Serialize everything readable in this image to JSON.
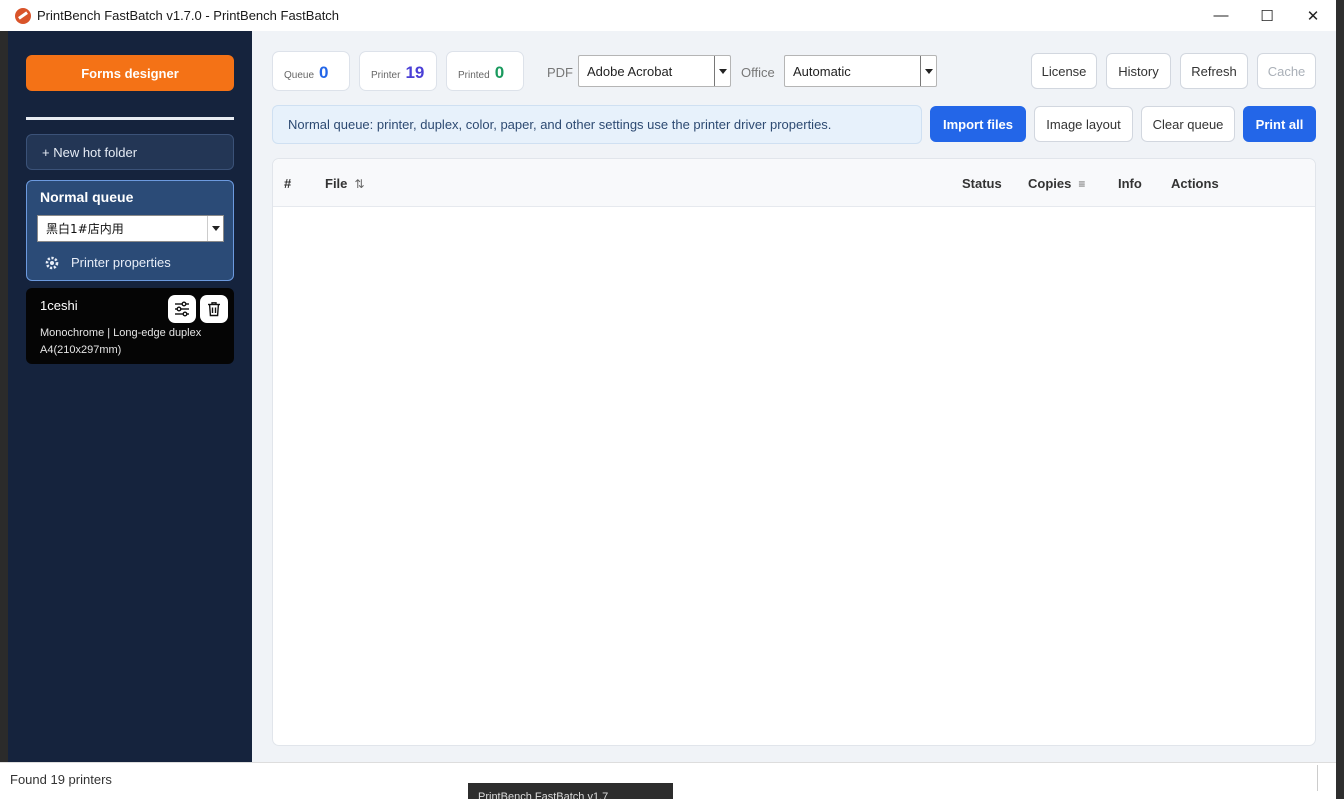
{
  "window": {
    "title": "PrintBench FastBatch v1.7.0 - PrintBench FastBatch",
    "minimize": "—",
    "maximize": "☐",
    "close": "✕"
  },
  "sidebar": {
    "forms_designer": "Forms designer",
    "new_hot_folder": "+ New hot folder",
    "queue": {
      "title": "Normal queue",
      "printer": "黑白1#店内用",
      "printer_properties": "Printer properties"
    },
    "preset": {
      "name": "1ceshi",
      "line1": "Monochrome | Long-edge duplex",
      "line2": "A4(210x297mm)"
    }
  },
  "stats": [
    {
      "label": "Queue",
      "value": "0",
      "color": "#2366e8"
    },
    {
      "label": "Printer",
      "value": "19",
      "color": "#4a3fd6"
    },
    {
      "label": "Printed",
      "value": "0",
      "color": "#1a9a5e"
    }
  ],
  "toolbar": {
    "pdf_label": "PDF",
    "pdf_value": "Adobe Acrobat",
    "office_label": "Office",
    "office_value": "Automatic",
    "license": "License",
    "history": "History",
    "refresh": "Refresh",
    "cache": "Cache"
  },
  "info_bar": "Normal queue: printer, duplex, color, paper, and other settings use the printer driver properties.",
  "actions": {
    "import_files": "Import files",
    "image_layout": "Image layout",
    "clear_queue": "Clear queue",
    "print_all": "Print all"
  },
  "table": {
    "columns": {
      "num": "#",
      "file": "File",
      "status": "Status",
      "copies": "Copies",
      "info": "Info",
      "actions": "Actions"
    },
    "sort_glyph": "⇅",
    "filter_glyph": "≡",
    "rows": []
  },
  "status_bar": "Found 19 printers",
  "taskbar_thumb": "PrintBench FastBatch v1.7"
}
